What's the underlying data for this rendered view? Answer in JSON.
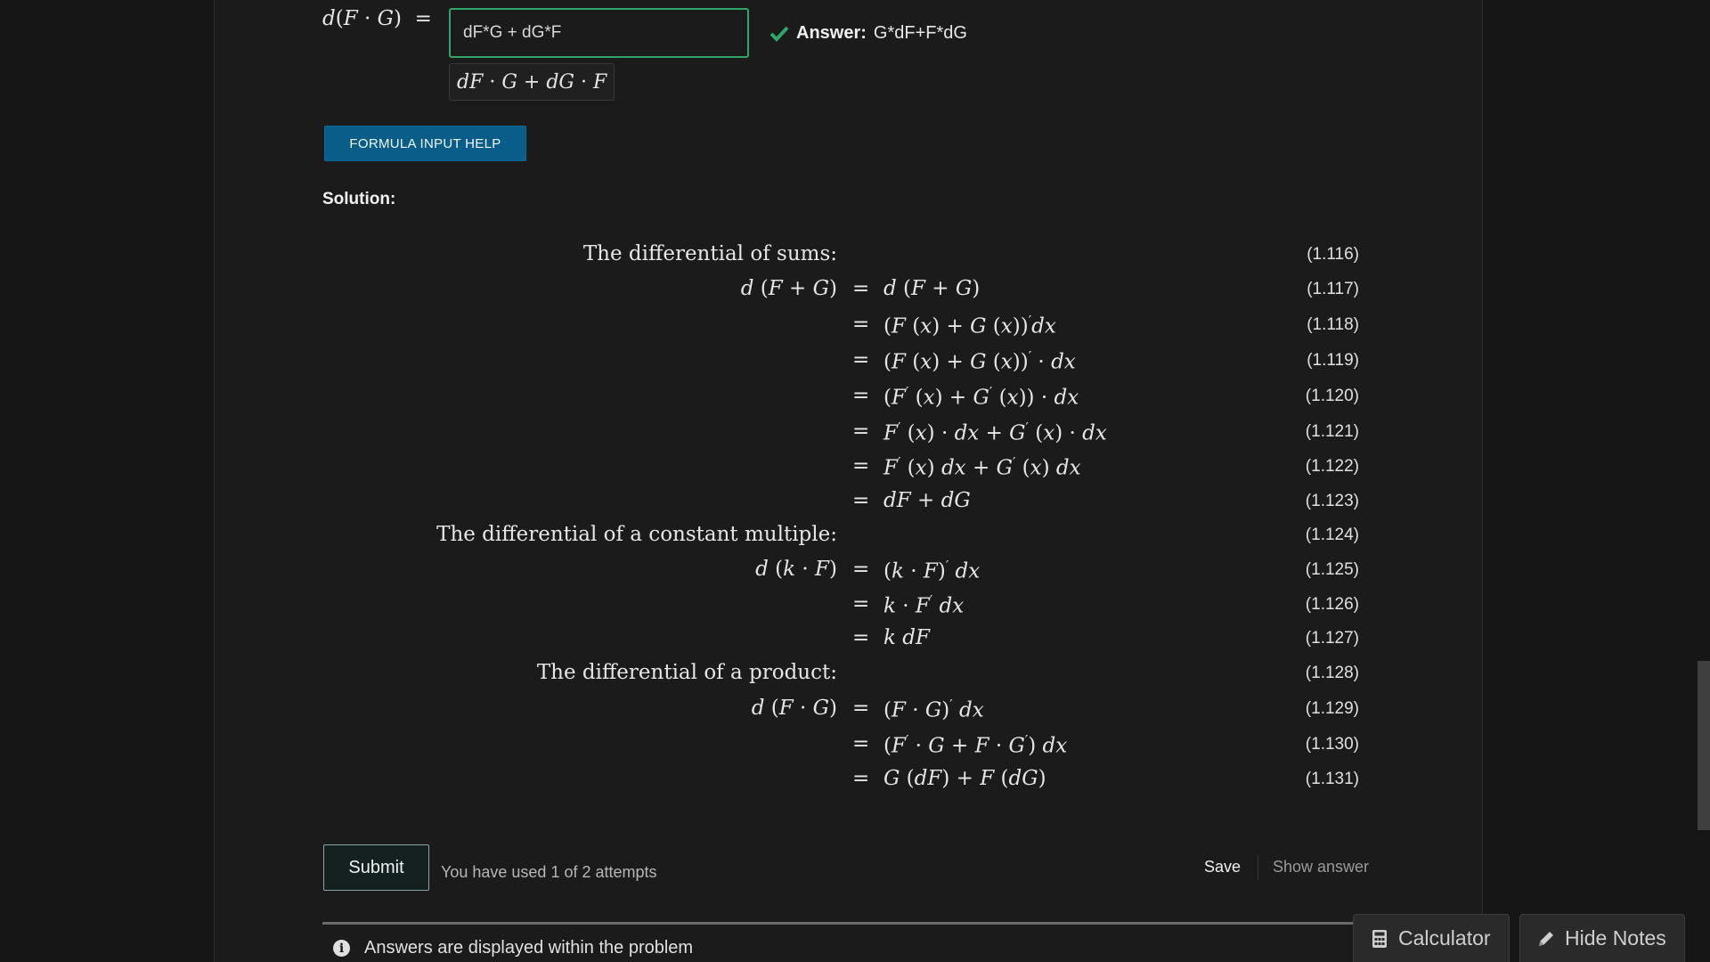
{
  "question": {
    "input_value": "dF*G + dG*F",
    "answer_label": "Answer:",
    "answer_value": "G*dF+F*dG",
    "help_button": "FORMULA INPUT HELP"
  },
  "solution": {
    "title": "Solution:",
    "lines": [
      {
        "kind": "text",
        "text": "The differential of sums:",
        "num": "(1.116)"
      },
      {
        "kind": "eq",
        "num": "(1.117)"
      },
      {
        "kind": "eq",
        "num": "(1.118)"
      },
      {
        "kind": "eq",
        "num": "(1.119)"
      },
      {
        "kind": "eq",
        "num": "(1.120)"
      },
      {
        "kind": "eq",
        "num": "(1.121)"
      },
      {
        "kind": "eq",
        "num": "(1.122)"
      },
      {
        "kind": "eq",
        "num": "(1.123)"
      },
      {
        "kind": "text",
        "text": "The differential of a constant multiple:",
        "num": "(1.124)"
      },
      {
        "kind": "eq",
        "num": "(1.125)"
      },
      {
        "kind": "eq",
        "num": "(1.126)"
      },
      {
        "kind": "eq",
        "num": "(1.127)"
      },
      {
        "kind": "text",
        "text": "The differential of a product:",
        "num": "(1.128)"
      },
      {
        "kind": "eq",
        "num": "(1.129)"
      },
      {
        "kind": "eq",
        "num": "(1.130)"
      },
      {
        "kind": "eq",
        "num": "(1.131)"
      }
    ]
  },
  "actions": {
    "submit": "Submit",
    "attempts": "You have used 1 of 2 attempts",
    "save": "Save",
    "show_answer": "Show answer"
  },
  "notice": "Answers are displayed within the problem",
  "tools": {
    "calculator": "Calculator",
    "hide_notes": "Hide Notes"
  },
  "colors": {
    "success": "#2fa56a",
    "help_button": "#0a5d88"
  },
  "icons": [
    "check-icon",
    "info-icon",
    "calculator-icon",
    "pencil-icon"
  ]
}
